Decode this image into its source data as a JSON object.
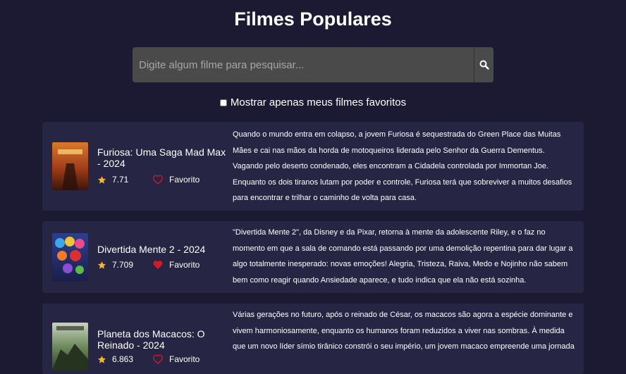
{
  "header": {
    "title": "Filmes Populares"
  },
  "search": {
    "placeholder": "Digite algum filme para pesquisar...",
    "value": "",
    "icon": "search-icon"
  },
  "filter": {
    "label": "Mostrar apenas meus filmes favoritos",
    "checked": false
  },
  "colors": {
    "background": "#1c1a33",
    "card": "#272544",
    "star": "#f5b530",
    "heart": "#d11a2a"
  },
  "movies": [
    {
      "title": "Furiosa: Uma Saga Mad Max - 2024",
      "rating": "7.71",
      "favorite_label": "Favorito",
      "is_favorite": false,
      "overview": "Quando o mundo entra em colapso, a jovem Furiosa é sequestrada do Green Place das Muitas Mães e cai nas mãos da horda de motoqueiros liderada pelo Senhor da Guerra Dementus. Vagando pelo deserto condenado, eles encontram a Cidadela controlada por Immortan Joe. Enquanto os dois tiranos lutam por poder e controle, Furiosa terá que sobreviver a muitos desafios para encontrar e trilhar o caminho de volta para casa."
    },
    {
      "title": "Divertida Mente 2 - 2024",
      "rating": "7.709",
      "favorite_label": "Favorito",
      "is_favorite": true,
      "overview": "\"Divertida Mente 2\", da Disney e da Pixar, retorna à mente da adolescente Riley, e o faz no momento em que a sala de comando está passando por uma demolição repentina para dar lugar a algo totalmente inesperado: novas emoções! Alegria, Tristeza, Raiva, Medo e Nojinho não sabem bem como reagir quando Ansiedade aparece, e tudo indica que ela não está sozinha."
    },
    {
      "title": "Planeta dos Macacos: O Reinado - 2024",
      "rating": "6.863",
      "favorite_label": "Favorito",
      "is_favorite": false,
      "overview": "Várias gerações no futuro, após o reinado de César, os macacos são agora a espécie dominante e vivem harmoniosamente, enquanto os humanos foram reduzidos a viver nas sombras. À medida que um novo líder símio tirânico constrói o seu império, um jovem macaco empreende uma jornada"
    }
  ]
}
